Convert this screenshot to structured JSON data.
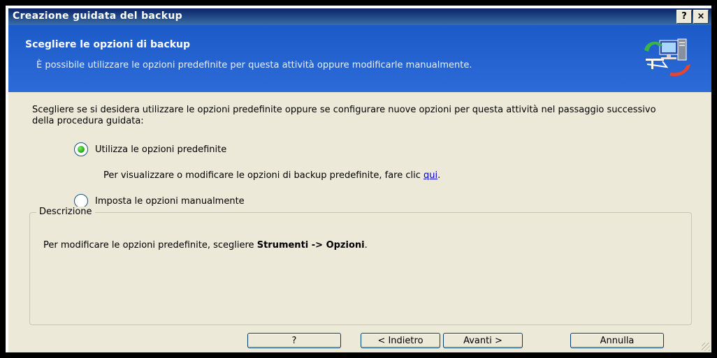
{
  "window": {
    "title": "Creazione guidata del backup",
    "help_button": "?",
    "close_button": "×"
  },
  "banner": {
    "heading": "Scegliere le opzioni di backup",
    "subtext": "È possibile utilizzare le opzioni predefinite per questa attività oppure modificarle manualmente.",
    "icon": "computer-network-icon"
  },
  "content": {
    "intro": "Scegliere se si desidera utilizzare le opzioni predefinite oppure se configurare nuove opzioni per questa attività nel passaggio successivo della procedura guidata:",
    "option_default": {
      "label": "Utilizza le opzioni predefinite",
      "selected": true
    },
    "helper_text": "Per visualizzare o modificare le opzioni di backup predefinite, fare clic",
    "helper_link": "qui",
    "option_manual": {
      "label": "Imposta le opzioni manualmente",
      "selected": false
    },
    "description_title": "Descrizione",
    "description_prefix": "Per modificare le opzioni predefinite, scegliere",
    "description_bold": "Strumenti -> Opzioni",
    "description_suffix": "."
  },
  "buttons": {
    "help": "?",
    "back": "< Indietro",
    "next": "Avanti >",
    "cancel": "Annulla"
  },
  "colors": {
    "titlebar": "#0A246A",
    "banner": "#1C5AC8",
    "window_bg": "#ECE9D8",
    "radio_selected": "#22A51A",
    "link": "#0000CC"
  }
}
